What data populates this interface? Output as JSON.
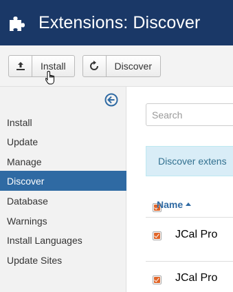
{
  "header": {
    "title": "Extensions: Discover",
    "icon": "puzzle-icon",
    "background": "#1a3867"
  },
  "toolbar": {
    "install_label": "Install",
    "discover_label": "Discover"
  },
  "sidebar": {
    "items": [
      {
        "label": "Install",
        "active": false
      },
      {
        "label": "Update",
        "active": false
      },
      {
        "label": "Manage",
        "active": false
      },
      {
        "label": "Discover",
        "active": true
      },
      {
        "label": "Database",
        "active": false
      },
      {
        "label": "Warnings",
        "active": false
      },
      {
        "label": "Install Languages",
        "active": false
      },
      {
        "label": "Update Sites",
        "active": false
      }
    ],
    "active_color": "#2f6aa3"
  },
  "main": {
    "search_placeholder": "Search",
    "alert_text": "Discover extens",
    "table": {
      "column_name": "Name",
      "sort": "ascending",
      "rows": [
        {
          "name": "JCal Pro",
          "checked": true
        },
        {
          "name": "JCal Pro",
          "checked": true
        }
      ]
    }
  },
  "colors": {
    "checkbox": "#e0662a",
    "link": "#2f6aa3",
    "alert_bg": "#d9edf7"
  }
}
